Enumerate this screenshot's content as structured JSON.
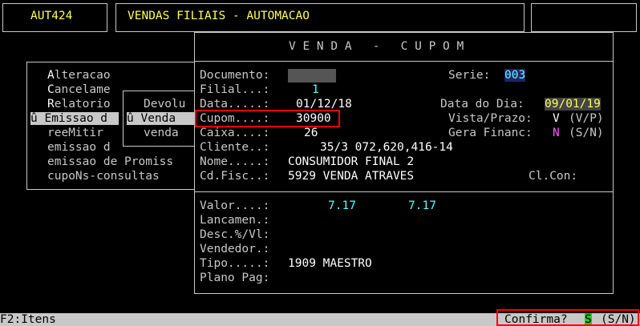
{
  "header": {
    "program_code": "AUT424",
    "system_title": "VENDAS FILIAIS - AUTOMACAO"
  },
  "main_menu": {
    "items": [
      {
        "hotkey": "A",
        "rest": "lteracao"
      },
      {
        "hotkey": "C",
        "rest": "ancelame"
      },
      {
        "hotkey": "R",
        "rest": "elatorio"
      },
      {
        "prefix": "û ",
        "hotkey": "E",
        "rest": "missao d"
      },
      {
        "prefix": "",
        "text": "reeMitir"
      },
      {
        "prefix": "",
        "text": "emissao d"
      },
      {
        "prefix": "",
        "text": "emissao de Promiss"
      },
      {
        "prefix": "",
        "text": "cupoNs-consultas"
      }
    ]
  },
  "sub_menu": {
    "items": [
      "Devolu",
      "û Venda",
      "venda"
    ]
  },
  "form": {
    "title": "V E N D A   -   C U P O M",
    "labels": {
      "documento": "Documento:",
      "filial": "Filial...:",
      "data": "Data.....:",
      "cupom": "Cupom....:",
      "caixa": "Caixa....:",
      "cliente": "Cliente..:",
      "nome": "Nome.....:",
      "cdfisc": "Cd.Fisc..:",
      "serie": "Serie:",
      "data_dia": "Data do Dia:",
      "vista_prazo": "Vista/Prazo:",
      "gera_financ": "Gera Financ:",
      "clcon": "Cl.Con:",
      "valor": "Valor....:",
      "lancamen": "Lancamen.:",
      "desc": "Desc.%/Vl:",
      "vendedor": "Vendedor.:",
      "tipo": "Tipo.....:",
      "plano": "Plano Pag:"
    },
    "values": {
      "filial": "1",
      "data": "01/12/18",
      "cupom": "30900",
      "caixa": "26",
      "cliente": "35/3 072,620,416-14",
      "nome": "CONSUMIDOR FINAL 2",
      "cdfisc": "5929 VENDA ATRAVES",
      "serie": "003",
      "data_dia": "09/01/19",
      "vista_prazo": "V",
      "vista_prazo_hint": "(V/P)",
      "gera_financ": "N",
      "gera_financ_hint": "(S/N)",
      "valor1": "7.17",
      "valor2": "7.17",
      "tipo": "1909 MAESTRO"
    }
  },
  "status_bar": {
    "f2_label": "F2:Itens",
    "confirm_label": "Confirma?",
    "confirm_value": "S",
    "confirm_hint": "(S/N)"
  },
  "colors": {
    "highlight_red": "#ff0000",
    "field_cyan": "#55ffff",
    "field_yellow": "#ffff55",
    "field_magenta": "#ff55ff"
  }
}
